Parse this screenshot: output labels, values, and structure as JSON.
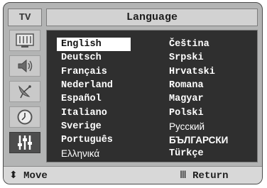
{
  "header": {
    "tv_tab": "TV",
    "title": "Language"
  },
  "sidebar": {
    "items": [
      {
        "icon": "picture-icon"
      },
      {
        "icon": "speaker-icon"
      },
      {
        "icon": "antenna-icon"
      },
      {
        "icon": "clock-icon"
      },
      {
        "icon": "setup-icon",
        "active": true
      }
    ]
  },
  "languages": {
    "left": [
      "English",
      "Deutsch",
      "Français",
      "Nederland",
      "Español",
      "Italiano",
      "Sverige",
      "Português",
      "Ελληνικά"
    ],
    "right": [
      "Čeština",
      "Srpski",
      "Hrvatski",
      "Romana",
      "Magyar",
      "Polski",
      "Русский",
      "БЪЛГАРСКИ",
      "Türkçe"
    ],
    "selected": "English"
  },
  "footer": {
    "move_glyph": "⬍",
    "move_label": "Move",
    "return_glyph": "Ⅲ",
    "return_label": "Return"
  },
  "colors": {
    "panel_bg": "#2f2f2f",
    "frame_bg": "#b3b4b4",
    "selected_bg": "#ffffff"
  }
}
